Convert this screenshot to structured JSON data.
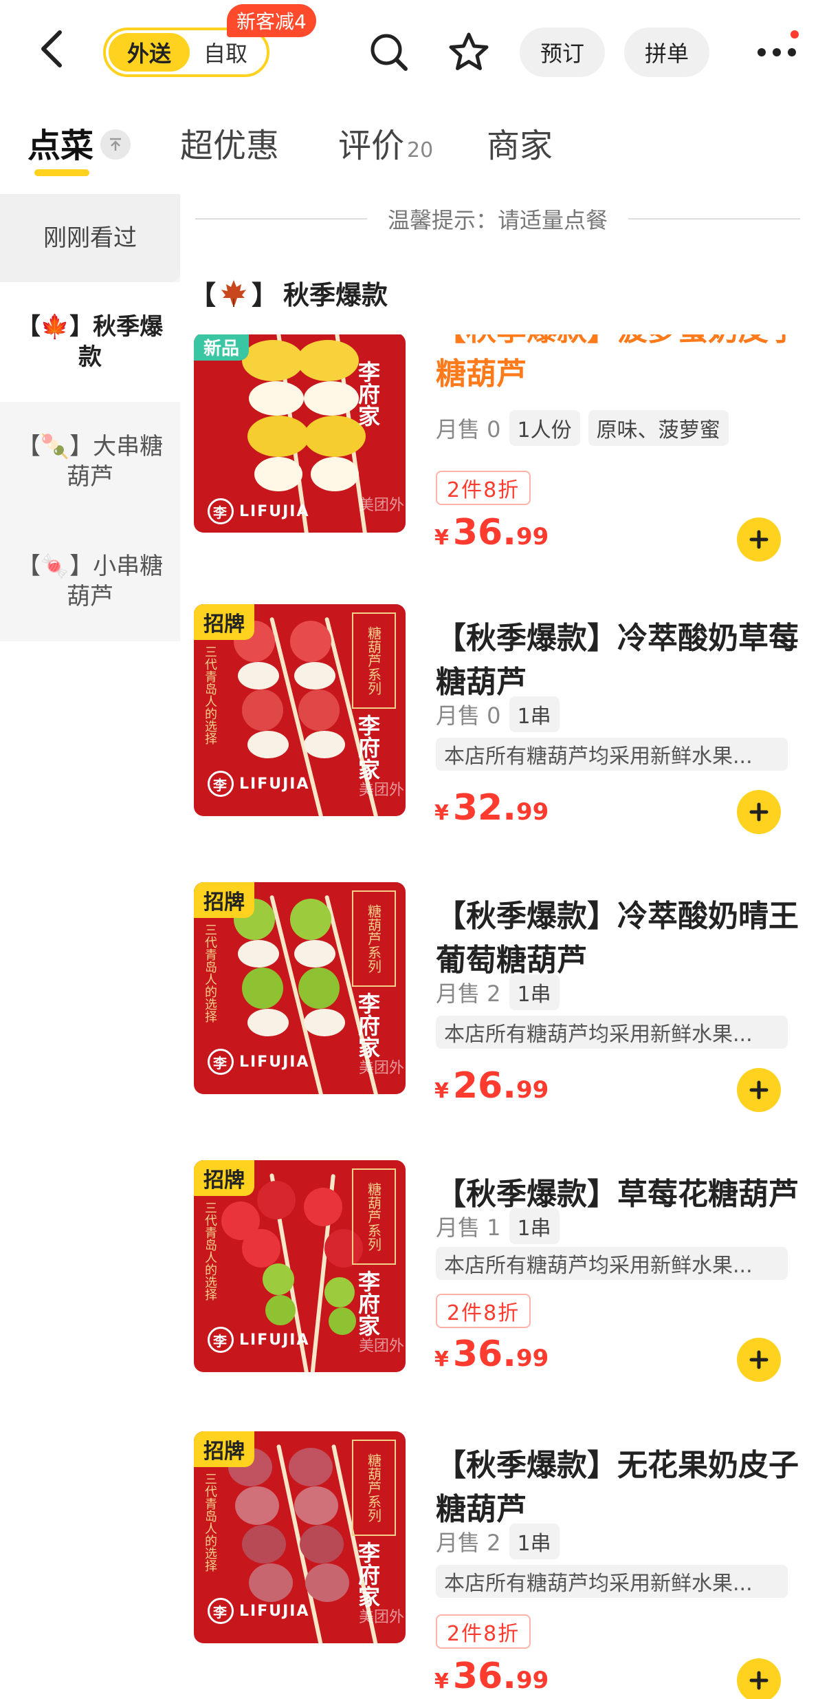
{
  "header": {
    "mode_delivery": "外送",
    "mode_pickup": "自取",
    "promo_badge": "新客减4",
    "reserve_label": "预订",
    "group_label": "拼单"
  },
  "tabs": [
    {
      "label": "点菜"
    },
    {
      "label": "超优惠"
    },
    {
      "label": "评价",
      "count": "20"
    },
    {
      "label": "商家"
    }
  ],
  "sidebar": {
    "items": [
      {
        "label": "刚刚看过"
      },
      {
        "label": "【🍁】秋季爆款"
      },
      {
        "label": "【🍡】大串糖葫芦"
      },
      {
        "label": "【🍬】小串糖葫芦"
      }
    ]
  },
  "tip": "温馨提示：请适量点餐",
  "section_title": "秋季爆款",
  "colors": {
    "accent": "#ffd21f",
    "price": "#ff3b2f",
    "new_badge": "#3bc6a3"
  },
  "products": [
    {
      "badge": "新品",
      "name": "【秋季爆款】菠萝蜜奶皮子糖葫芦",
      "sales": "月售 0",
      "chips": [
        "1人份",
        "原味、菠萝蜜"
      ],
      "desc": "",
      "discount": "2件8折",
      "price_symbol": "¥",
      "price_int": "36.",
      "price_dec": "99"
    },
    {
      "badge": "招牌",
      "name": "【秋季爆款】冷萃酸奶草莓糖葫芦",
      "sales": "月售 0",
      "chips": [
        "1串"
      ],
      "desc": "本店所有糖葫芦均采用新鲜水果...",
      "discount": "",
      "price_symbol": "¥",
      "price_int": "32.",
      "price_dec": "99"
    },
    {
      "badge": "招牌",
      "name": "【秋季爆款】冷萃酸奶晴王葡萄糖葫芦",
      "sales": "月售 2",
      "chips": [
        "1串"
      ],
      "desc": "本店所有糖葫芦均采用新鲜水果...",
      "discount": "",
      "price_symbol": "¥",
      "price_int": "26.",
      "price_dec": "99"
    },
    {
      "badge": "招牌",
      "name": "【秋季爆款】草莓花糖葫芦",
      "sales": "月售 1",
      "chips": [
        "1串"
      ],
      "desc": "本店所有糖葫芦均采用新鲜水果...",
      "discount": "2件8折",
      "price_symbol": "¥",
      "price_int": "36.",
      "price_dec": "99"
    },
    {
      "badge": "招牌",
      "name": "【秋季爆款】无花果奶皮子糖葫芦",
      "sales": "月售 2",
      "chips": [
        "1串"
      ],
      "desc": "本店所有糖葫芦均采用新鲜水果...",
      "discount": "2件8折",
      "price_symbol": "¥",
      "price_int": "36.",
      "price_dec": "99"
    }
  ],
  "thumb_text": {
    "brand": "李府家",
    "series": "糖葫芦系列",
    "slogan": "三代青岛人的选择",
    "logo": "LIFUJIA",
    "logo_char": "李",
    "watermark": "美团外"
  }
}
